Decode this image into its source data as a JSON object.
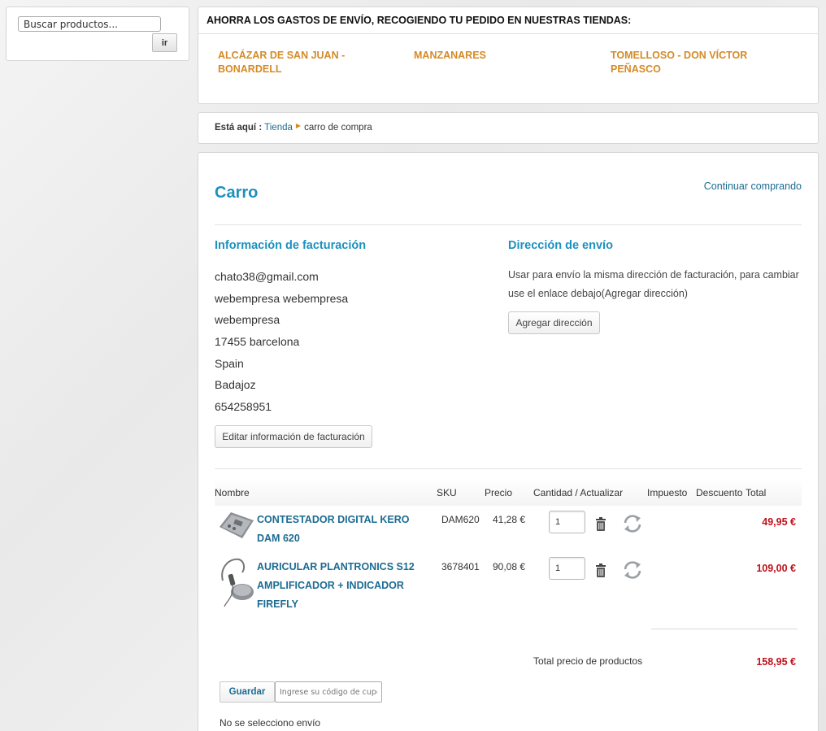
{
  "search": {
    "placeholder": "Buscar productos...",
    "go_label": "ir"
  },
  "stores": {
    "header": "AHORRA LOS GASTOS DE ENVÍO, RECOGIENDO TU PEDIDO EN NUESTRAS TIENDAS:",
    "items": [
      {
        "label": "ALCÁZAR DE SAN JUAN - BONARDELL"
      },
      {
        "label": "MANZANARES"
      },
      {
        "label": "TOMELLOSO - DON VÍCTOR PEÑASCO"
      }
    ]
  },
  "breadcrumb": {
    "label": "Está aquí :",
    "link": "Tienda",
    "current": "carro de compra"
  },
  "cart": {
    "title": "Carro",
    "continue": "Continuar comprando"
  },
  "billing": {
    "title": "Información de facturación",
    "lines": [
      "chato38@gmail.com",
      "webempresa webempresa",
      "webempresa",
      "17455 barcelona",
      "Spain",
      "Badajoz",
      "654258951"
    ],
    "edit_label": "Editar información de facturación"
  },
  "shipping": {
    "title": "Dirección de envío",
    "text": "Usar para envío la misma dirección de facturación, para cambiar use el enlace debajo(Agregar dirección)",
    "add_label": "Agregar dirección"
  },
  "table": {
    "headers": {
      "name": "Nombre",
      "sku": "SKU",
      "price": "Precio",
      "qty": "Cantidad / Actualizar",
      "tax": "Impuesto",
      "discount": "Descuento",
      "total": "Total"
    },
    "rows": [
      {
        "name": "CONTESTADOR DIGITAL KERO DAM 620",
        "sku": "DAM620",
        "price": "41,28 €",
        "qty": "1",
        "total": "49,95 €"
      },
      {
        "name": "AURICULAR PLANTRONICS S12 AMPLIFICADOR + INDICADOR FIREFLY",
        "sku": "3678401",
        "price": "90,08 €",
        "qty": "1",
        "total": "109,00 €"
      }
    ],
    "subtotal_label": "Total precio de productos",
    "subtotal_value": "158,95 €"
  },
  "coupon": {
    "save_label": "Guardar",
    "placeholder": "Ingrese su código de cupón"
  },
  "shipping_status": "No se selecciono envío",
  "icons": {
    "delete": "trash-icon",
    "update": "refresh-icon"
  },
  "colors": {
    "accent": "#1d91be",
    "link": "#1b6b92",
    "store": "#d48a26",
    "price": "#c0111a"
  }
}
